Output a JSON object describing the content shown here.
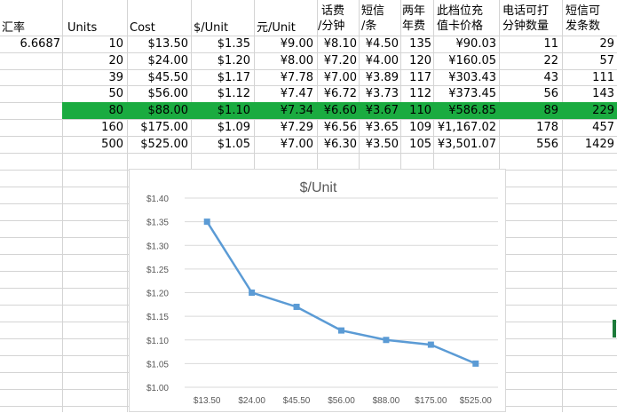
{
  "sheet": {
    "headers": {
      "rate": "汇率",
      "units": "Units",
      "cost": "Cost",
      "per_unit_usd": "$/Unit",
      "per_unit_cny": "元/Unit",
      "call_fee_line1": "话费",
      "call_fee_line2": "/分钟",
      "sms_line1": "短信",
      "sms_line2": "/条",
      "biennial_line1": "两年",
      "biennial_line2": "年费",
      "card_price_line1": "此档位充",
      "card_price_line2": "值卡价格",
      "call_minutes_line1": "电话可打",
      "call_minutes_line2": "分钟数量",
      "sms_count_line1": "短信可",
      "sms_count_line2": "发条数"
    },
    "rate_value": "6.6687",
    "rows": [
      {
        "units": "10",
        "cost": "$13.50",
        "usd": "$1.35",
        "cny": "¥9.00",
        "call": "¥8.10",
        "sms": "¥4.50",
        "biennial": "135",
        "card": "¥90.03",
        "minutes": "11",
        "sms_count": "29"
      },
      {
        "units": "20",
        "cost": "$24.00",
        "usd": "$1.20",
        "cny": "¥8.00",
        "call": "¥7.20",
        "sms": "¥4.00",
        "biennial": "120",
        "card": "¥160.05",
        "minutes": "22",
        "sms_count": "57"
      },
      {
        "units": "39",
        "cost": "$45.50",
        "usd": "$1.17",
        "cny": "¥7.78",
        "call": "¥7.00",
        "sms": "¥3.89",
        "biennial": "117",
        "card": "¥303.43",
        "minutes": "43",
        "sms_count": "111"
      },
      {
        "units": "50",
        "cost": "$56.00",
        "usd": "$1.12",
        "cny": "¥7.47",
        "call": "¥6.72",
        "sms": "¥3.73",
        "biennial": "112",
        "card": "¥373.45",
        "minutes": "56",
        "sms_count": "143"
      },
      {
        "units": "80",
        "cost": "$88.00",
        "usd": "$1.10",
        "cny": "¥7.34",
        "call": "¥6.60",
        "sms": "¥3.67",
        "biennial": "110",
        "card": "¥586.85",
        "minutes": "89",
        "sms_count": "229"
      },
      {
        "units": "160",
        "cost": "$175.00",
        "usd": "$1.09",
        "cny": "¥7.29",
        "call": "¥6.56",
        "sms": "¥3.65",
        "biennial": "109",
        "card": "¥1,167.02",
        "minutes": "178",
        "sms_count": "457"
      },
      {
        "units": "500",
        "cost": "$525.00",
        "usd": "$1.05",
        "cny": "¥7.00",
        "call": "¥6.30",
        "sms": "¥3.50",
        "biennial": "105",
        "card": "¥3,501.07",
        "minutes": "556",
        "sms_count": "1429"
      }
    ],
    "highlight_color": "#1aab40"
  },
  "chart_data": {
    "type": "line",
    "title": "$/Unit",
    "categories": [
      "$13.50",
      "$24.00",
      "$45.50",
      "$56.00",
      "$88.00",
      "$175.00",
      "$525.00"
    ],
    "values": [
      1.35,
      1.2,
      1.17,
      1.12,
      1.1,
      1.09,
      1.05
    ],
    "ylim": [
      1.0,
      1.4
    ],
    "yticks": [
      "$1.40",
      "$1.35",
      "$1.30",
      "$1.25",
      "$1.20",
      "$1.15",
      "$1.10",
      "$1.05",
      "$1.00"
    ],
    "grid": true,
    "series_color": "#5b9bd5"
  }
}
